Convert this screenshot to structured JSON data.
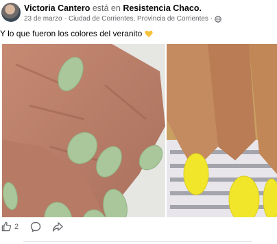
{
  "post": {
    "author": "Victoria Cantero",
    "verb": "está en",
    "place": "Resistencia Chaco.",
    "date": "23 de marzo",
    "separator": "·",
    "location": "Ciudad de Corrientes, Provincia de Corrientes",
    "separator2": "·",
    "caption": "Y lo que fueron los colores del veranito",
    "caption_emoji": "yellow-heart-icon"
  },
  "photos": {
    "left": {
      "subject": "hands with sage green nails",
      "nail_color": "#a9c79a"
    },
    "right": {
      "subject": "hand with yellow nails",
      "nail_color": "#f1e62a"
    }
  },
  "actions": {
    "like_count": "2",
    "like_icon": "thumbs-up-icon",
    "comment_icon": "comment-icon",
    "share_icon": "share-icon"
  },
  "colors": {
    "secondary_text": "#65676b",
    "heart": "#f5c33b"
  }
}
